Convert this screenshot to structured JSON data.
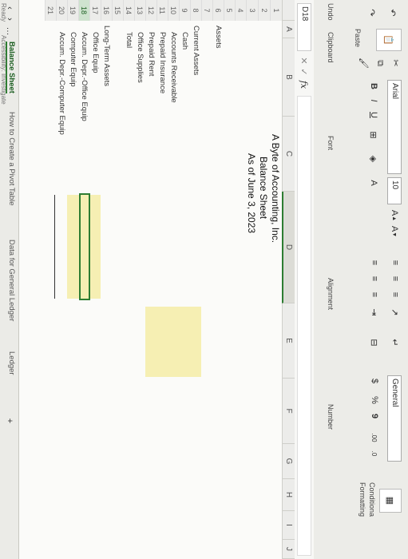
{
  "ribbon": {
    "undo_label": "Undo",
    "paste_label": "Paste",
    "clipboard_label": "Clipboard",
    "font_name": "Arial",
    "font_size": "10",
    "font_label": "Font",
    "alignment_label": "Alignment",
    "number_format": "General",
    "currency_symbol": "$",
    "percent_symbol": "%",
    "comma_symbol": "9",
    "number_label": "Number",
    "conditional_label_1": "Conditiona",
    "conditional_label_2": "Formatting"
  },
  "formula_bar": {
    "name_box": "D18",
    "fx": "fx"
  },
  "columns": [
    "A",
    "B",
    "C",
    "D",
    "E",
    "F",
    "G",
    "H",
    "I",
    "J"
  ],
  "rows": [
    "1",
    "2",
    "3",
    "4",
    "5",
    "6",
    "7",
    "8",
    "9",
    "10",
    "11",
    "12",
    "13",
    "14",
    "15",
    "16",
    "17",
    "18",
    "19",
    "20",
    "21"
  ],
  "sheet": {
    "company": "A Byte of Accounting, Inc.",
    "statement": "Balance Sheet",
    "date": "As of June 3, 2023",
    "assets": "Assets",
    "current_assets": "Current Assets",
    "cash": "Cash",
    "accounts_receivable": "Accounts Receivable",
    "prepaid_insurance": "Prepaid Insurance",
    "prepaid_rent": "Prepaid Rent",
    "office_supplies": "Office Supplies",
    "total": "Total",
    "long_term_assets": "Long-Term Assets",
    "office_equip": "Office Equip",
    "accum_depr_office": "Accum. Depr.-Office Equip",
    "computer_equip": "Computer Equip",
    "accum_depr_computer": "Accum. Depr.-Computer Equip"
  },
  "tabs": [
    "Balance Sheet",
    "How to Create a Pivot Table",
    "Data for General Ledger",
    "Ledger"
  ],
  "status": {
    "ready": "Ready",
    "accessibility": "Accessibility: Investigate"
  },
  "colors": {
    "highlight": "#f6efb3",
    "selection": "#2e7d32"
  }
}
